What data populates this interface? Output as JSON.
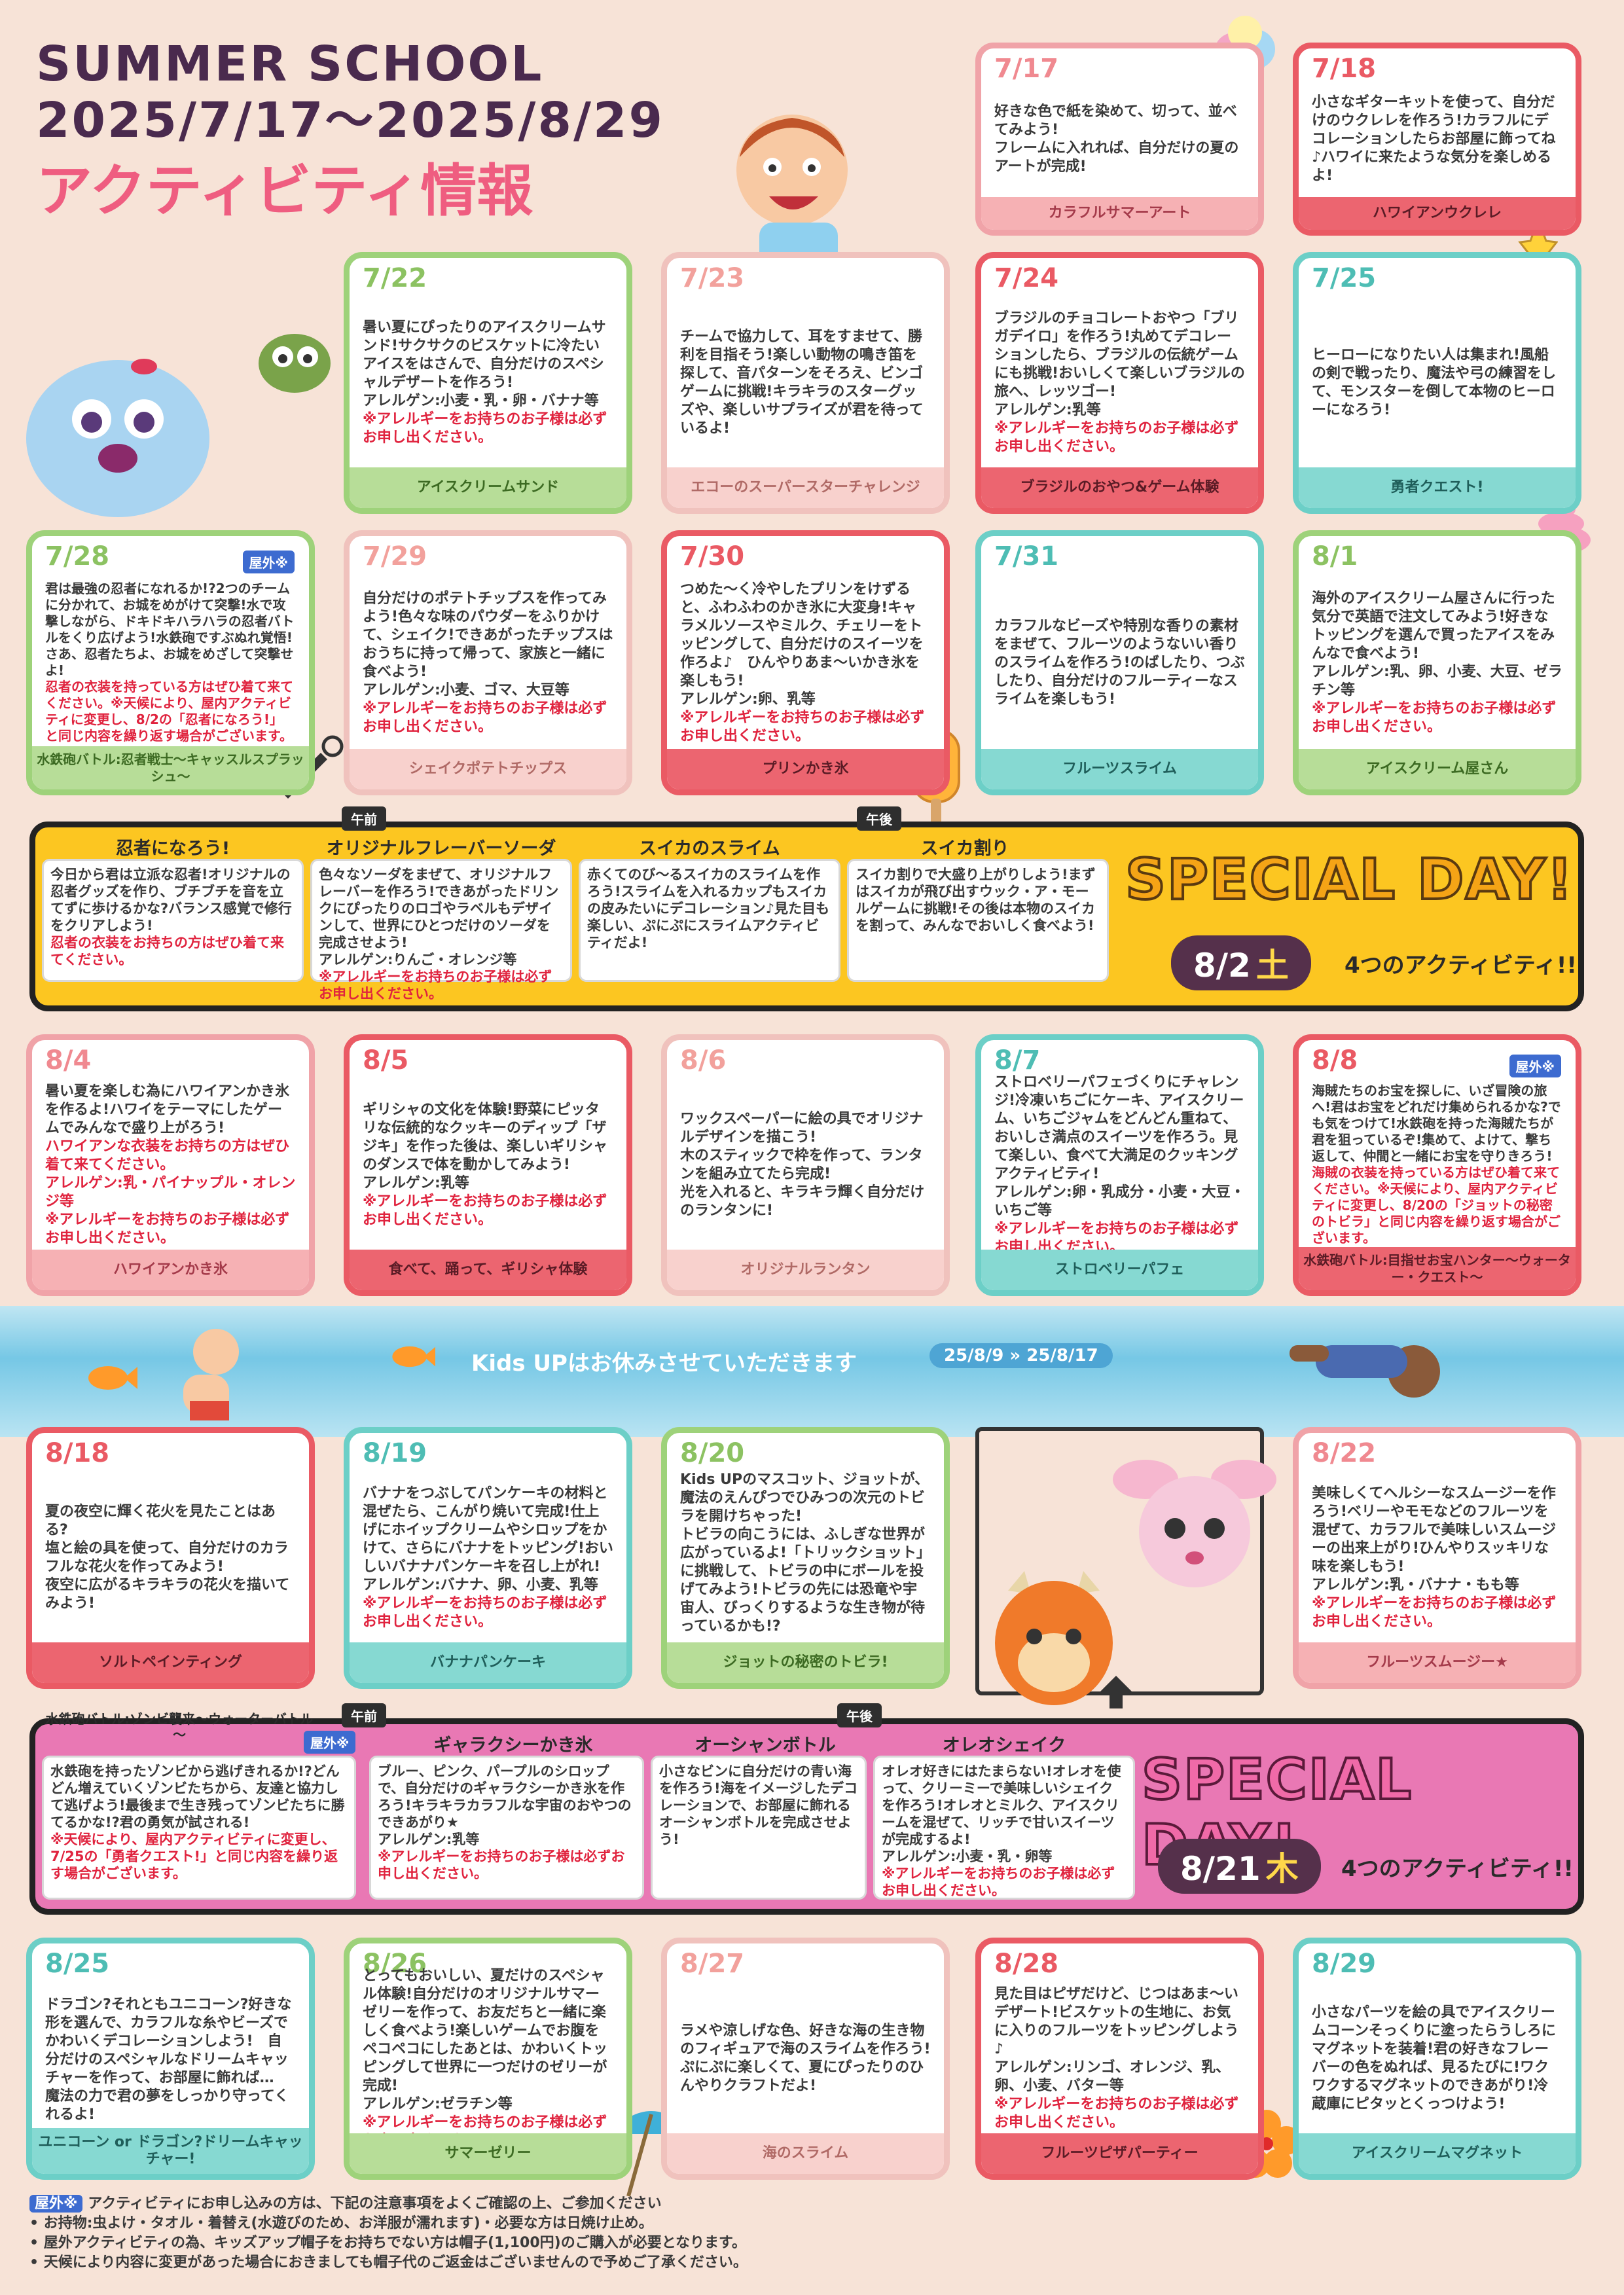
{
  "header": {
    "title1": "SUMMER SCHOOL",
    "title2": "2025/7/17～2025/8/29",
    "title3": "アクティビティ情報"
  },
  "cards": [
    {
      "date": "7/17",
      "body": "好きな色で紙を染めて、切って、並べてみよう!\nフレームに入れれば、自分だけの夏のアートが完成!",
      "note": "",
      "foot": "カラフルサマーアート"
    },
    {
      "date": "7/18",
      "body": "小さなギターキットを使って、自分だけのウクレレを作ろう!カラフルにデコレーションしたらお部屋に飾ってね♪ハワイに来たような気分を楽しめるよ!",
      "note": "",
      "foot": "ハワイアンウクレレ"
    },
    {
      "date": "7/22",
      "body": "暑い夏にぴったりのアイスクリームサンド!サクサクのビスケットに冷たいアイスをはさんで、自分だけのスペシャルデザートを作ろう!\nアレルゲン:小麦・乳・卵・バナナ等",
      "note": "※アレルギーをお持ちのお子様は必ずお申し出ください。",
      "foot": "アイスクリームサンド"
    },
    {
      "date": "7/23",
      "body": "チームで協力して、耳をすませて、勝利を目指そう!楽しい動物の鳴き笛を探して、音パターンをそろえ、ビンゴゲームに挑戦!キラキラのスターグッズや、楽しいサプライズが君を待っているよ!",
      "note": "",
      "foot": "エコーのスーパースターチャレンジ"
    },
    {
      "date": "7/24",
      "body": "ブラジルのチョコレートおやつ「ブリガデイロ」を作ろう!丸めてデコレーションしたら、ブラジルの伝統ゲームにも挑戦!おいしくて楽しいブラジルの旅へ、レッツゴー!\nアレルゲン:乳等",
      "note": "※アレルギーをお持ちのお子様は必ずお申し出ください。",
      "foot": "ブラジルのおやつ&ゲーム体験"
    },
    {
      "date": "7/25",
      "body": "ヒーローになりたい人は集まれ!風船の剣で戦ったり、魔法や弓の練習をして、モンスターを倒して本物のヒーローになろう!",
      "note": "",
      "foot": "勇者クエスト!"
    },
    {
      "date": "7/28",
      "badge": "屋外※",
      "body": "君は最強の忍者になれるか!?2つのチームに分かれて、お城をめがけて突撃!水で攻撃しながら、ドキドキハラハラの忍者バトルをくり広げよう!水鉄砲ですぶぬれ覚悟!さあ、忍者たちよ、お城をめざして突撃せよ!",
      "note": "忍者の衣装を持っている方はぜひ着て来てください。※天候により、屋内アクティビティに変更し、8/2の「忍者になろう!」と同じ内容を繰り返す場合がございます。",
      "foot": "水鉄砲バトル:忍者戦士～キャッスルスプラッシュ～"
    },
    {
      "date": "7/29",
      "body": "自分だけのポテトチップスを作ってみよう!色々な味のパウダーをふりかけて、シェイク!できあがったチップスはおうちに持って帰って、家族と一緒に食べよう!\nアレルゲン:小麦、ゴマ、大豆等",
      "note": "※アレルギーをお持ちのお子様は必ずお申し出ください。",
      "foot": "シェイクポテトチップス"
    },
    {
      "date": "7/30",
      "body": "つめた〜く冷やしたプリンをけずると、ふわふわのかき氷に大変身!キャラメルソースやミルク、チェリーをトッピングして、自分だけのスイーツを作ろよ♪　ひんやりあま〜いかき氷を楽しもう!\nアレルゲン:卵、乳等",
      "note": "※アレルギーをお持ちのお子様は必ずお申し出ください。",
      "foot": "プリンかき氷"
    },
    {
      "date": "7/31",
      "body": "カラフルなビーズや特別な香りの素材をまぜて、フルーツのようないい香りのスライムを作ろう!のばしたり、つぶしたり、自分だけのフルーティーなスライムを楽しもう!",
      "note": "",
      "foot": "フルーツスライム"
    },
    {
      "date": "8/1",
      "body": "海外のアイスクリーム屋さんに行った気分で英語で注文してみよう!好きなトッピングを選んで買ったアイスをみんなで食べよう!\nアレルゲン:乳、卵、小麦、大豆、ゼラチン等",
      "note": "※アレルギーをお持ちのお子様は必ずお申し出ください。",
      "foot": "アイスクリーム屋さん"
    },
    {
      "date": "8/4",
      "body": "暑い夏を楽しむ為にハワイアンかき氷を作るよ!ハワイをテーマにしたゲームでみんなで盛り上がろう!",
      "note": "ハワイアンな衣装をお持ちの方はぜひ着て来てください。\nアレルゲン:乳・パイナップル・オレンジ等\n※アレルギーをお持ちのお子様は必ずお申し出ください。",
      "foot": "ハワイアンかき氷"
    },
    {
      "date": "8/5",
      "body": "ギリシャの文化を体験!野菜にピッタリな伝統的なクッキーのディップ「ザジキ」を作った後は、楽しいギリシャのダンスで体を動かしてみよう!\nアレルゲン:乳等",
      "note": "※アレルギーをお持ちのお子様は必ずお申し出ください。",
      "foot": "食べて、踊って、ギリシャ体験"
    },
    {
      "date": "8/6",
      "body": "ワックスペーパーに絵の具でオリジナルデザインを描こう!\n木のスティックで枠を作って、ランタンを組み立てたら完成!\n光を入れると、キラキラ輝く自分だけのランタンに!",
      "note": "",
      "foot": "オリジナルランタン"
    },
    {
      "date": "8/7",
      "body": "ストロベリーパフェづくりにチャレンジ!冷凍いちごにケーキ、アイスクリーム、いちごジャムをどんどん重ねて、おいしさ満点のスイーツを作ろう。見て楽しい、食べて大満足のクッキングアクティビティ!\nアレルゲン:卵・乳成分・小麦・大豆・いちご等",
      "note": "※アレルギーをお持ちのお子様は必ずお申し出ください。",
      "foot": "ストロベリーパフェ"
    },
    {
      "date": "8/8",
      "badge": "屋外※",
      "body": "海賊たちのお宝を探しに、いざ冒険の旅へ!君はお宝をどれだけ集められるかな?でも気をつけて!水鉄砲を持った海賊たちが君を狙っているぞ!集めて、よけて、撃ち返して、仲間と一緒にお宝を守りきろう!",
      "note": "海賊の衣装を持っている方はぜひ着て来てください。※天候により、屋内アクティビティに変更し、8/20の「ジョットの秘密のトビラ」と同じ内容を繰り返す場合がございます。",
      "foot": "水鉄砲バトル:目指せお宝ハンター～ウォーター・クエスト～"
    },
    {
      "date": "8/18",
      "body": "夏の夜空に輝く花火を見たことはある?\n塩と絵の具を使って、自分だけのカラフルな花火を作ってみよう!\n夜空に広がるキラキラの花火を描いてみよう!",
      "note": "",
      "foot": "ソルトペインティング"
    },
    {
      "date": "8/19",
      "body": "バナナをつぶしてパンケーキの材料と混ぜたら、こんがり焼いて完成!仕上げにホイップクリームやシロップをかけて、さらにバナナをトッピング!おいしいバナナパンケーキを召し上がれ!\nアレルゲン:バナナ、卵、小麦、乳等",
      "note": "※アレルギーをお持ちのお子様は必ずお申し出ください。",
      "foot": "バナナパンケーキ"
    },
    {
      "date": "8/20",
      "body": "Kids UPのマスコット、ジョットが、魔法のえんぴつでひみつの次元のトビラを開けちゃった!\nトビラの向こうには、ふしぎな世界が広がっているよ!「トリックショット」に挑戦して、トビラの中にボールを投げてみよう!トビラの先には恐竜や宇宙人、びっくりするような生き物が待っているかも!?",
      "note": "",
      "foot": "ジョットの秘密のトビラ!"
    },
    {
      "date": "8/22",
      "body": "美味しくてヘルシーなスムージーを作ろう!ベリーやモモなどのフルーツを混ぜて、カラフルで美味しいスムージーの出来上がり!ひんやりスッキリな味を楽しもう!\nアレルゲン:乳・バナナ・もも等",
      "note": "※アレルギーをお持ちのお子様は必ずお申し出ください。",
      "foot": "フルーツスムージー★"
    },
    {
      "date": "8/25",
      "body": "ドラゴン?それともユニコーン?好きな形を選んで、カラフルな糸やビーズでかわいくデコレーションしよう!　自分だけのスペシャルなドリームキャッチャーを作って、お部屋に飾れば…　魔法の力で君の夢をしっかり守ってくれるよ!",
      "note": "",
      "foot": "ユニコーン or ドラゴン?ドリームキャッチャー!"
    },
    {
      "date": "8/26",
      "body": "とってもおいしい、夏だけのスペシャル体験!自分だけのオリジナルサマーゼリーを作って、お友だちと一緒に楽しく食べよう!楽しいゲームでお腹をペコペコにしたあとは、かわいくトッピングして世界に一つだけのゼリーが完成!\nアレルゲン:ゼラチン等",
      "note": "※アレルギーをお持ちのお子様は必ずお申し出ください。",
      "foot": "サマーゼリー"
    },
    {
      "date": "8/27",
      "body": "ラメや涼しげな色、好きな海の生き物のフィギュアで海のスライムを作ろう!ぷにぷに楽しくて、夏にぴったりのひんやりクラフトだよ!",
      "note": "",
      "foot": "海のスライム"
    },
    {
      "date": "8/28",
      "body": "見た目はピザだけど、じつはあま〜いデザート!ビスケットの生地に、お気に入りのフルーツをトッピングしよう♪\nアレルゲン:リンゴ、オレンジ、乳、卵、小麦、バター等",
      "note": "※アレルギーをお持ちのお子様は必ずお申し出ください。",
      "foot": "フルーツピザパーティー"
    },
    {
      "date": "8/29",
      "body": "小さなパーツを絵の具でアイスクリームコーンそっくりに塗ったらうしろにマグネットを装着!君の好きなフレーバーの色をぬれば、見るたびに!ワクワクするマグネットのできあがり!冷蔵庫にピタッとくっつけよう!",
      "note": "",
      "foot": "アイスクリームマグネット"
    }
  ],
  "sp1": {
    "am": "午前",
    "pm": "午後",
    "titles": [
      "忍者になろう!",
      "オリジナルフレーバーソーダ",
      "スイカのスライム",
      "スイカ割り"
    ],
    "bodies": [
      "今日から君は立派な忍者!オリジナルの忍者グッズを作り、ブチブチを音を立てずに歩けるかな?バランス感覚で修行をクリアしよう!",
      "色々なソーダをまぜて、オリジナルフレーバーを作ろう!できあがったドリンクにぴったりのロゴやラベルもデザインして、世界にひとつだけのソーダを完成させよう!\nアレルゲン:りんご・オレンジ等",
      "赤くてのび〜るスイカのスライムを作ろう!スライムを入れるカップもスイカの皮みたいにデコレーション♪見た目も楽しい、ぷにぷにスライムアクティビティだよ!",
      "スイカ割りで大盛り上がりしよう!まずはスイカが飛び出すウック・ア・モールゲームに挑戦!その後は本物のスイカを割って、みんなでおいしく食べよう!"
    ],
    "notes": [
      "忍者の衣装をお持ちの方はぜひ着て来てください。",
      "※アレルギーをお持ちのお子様は必ずお申し出ください。",
      "",
      ""
    ],
    "big": "SPECIAL DAY!",
    "date": "8/2",
    "dow": "土",
    "four": "4つのアクティビティ!!"
  },
  "sp2": {
    "am": "午前",
    "pm": "午後",
    "badge": "屋外※",
    "titles": [
      "水鉄砲バトル:ゾンビ襲来～ウォーターバトル～",
      "ギャラクシーかき氷",
      "オーシャンボトル",
      "オレオシェイク"
    ],
    "bodies": [
      "水鉄砲を持ったゾンビから逃げきれるか!?どんどん増えていくゾンビたちから、友達と協力して逃げよう!最後まで生き残ってゾンビたちに勝てるかな!?君の勇気が試される!",
      "ブルー、ピンク、パープルのシロップで、自分だけのギャラクシーかき氷を作ろう!キラキラカラフルな宇宙のおやつのできあがり★\nアレルゲン:乳等",
      "小さなビンに自分だけの青い海を作ろう!海をイメージしたデコレーションで、お部屋に飾れるオーシャンボトルを完成させよう!",
      "オレオ好きにはたまらない!オレオを使って、クリーミーで美味しいシェイクを作ろう!オレオとミルク、アイスクリームを混ぜて、リッチで甘いスイーツが完成するよ!\nアレルゲン:小麦・乳・卵等"
    ],
    "notes": [
      "※天候により、屋内アクティビティに変更し、7/25の「勇者クエスト!」と同じ内容を繰り返す場合がございます。",
      "※アレルギーをお持ちのお子様は必ずお申し出ください。",
      "",
      "※アレルギーをお持ちのお子様は必ずお申し出ください。"
    ],
    "big": "SPECIAL DAY!",
    "date": "8/21",
    "dow": "木",
    "four": "4つのアクティビティ!!"
  },
  "break": {
    "text": "Kids UPはお休みさせていただきます",
    "dates": "25/8/9 » 25/8/17"
  },
  "footer": {
    "badge": "屋外※",
    "lines": [
      "アクティビティにお申し込みの方は、下記の注意事項をよくご確認の上、ご参加ください",
      "お持物:虫よけ・タオル・着替え(水遊びのため、お洋服が濡れます)・必要な方は日焼け止め。",
      "屋外アクティビティの為、キッズアップ帽子をお持ちでない方は帽子(1,100円)のご購入が必要となります。",
      "天候により内容に変更があった場合におきましても帽子代のご返金はございませんので予めご了承ください。"
    ]
  },
  "colors": {
    "pink": "#f0a3a8",
    "red": "#ea5a64",
    "green": "#9ed27a",
    "teal": "#6ccfc7",
    "yellow": "#fcc621",
    "magenta": "#e9559a"
  }
}
